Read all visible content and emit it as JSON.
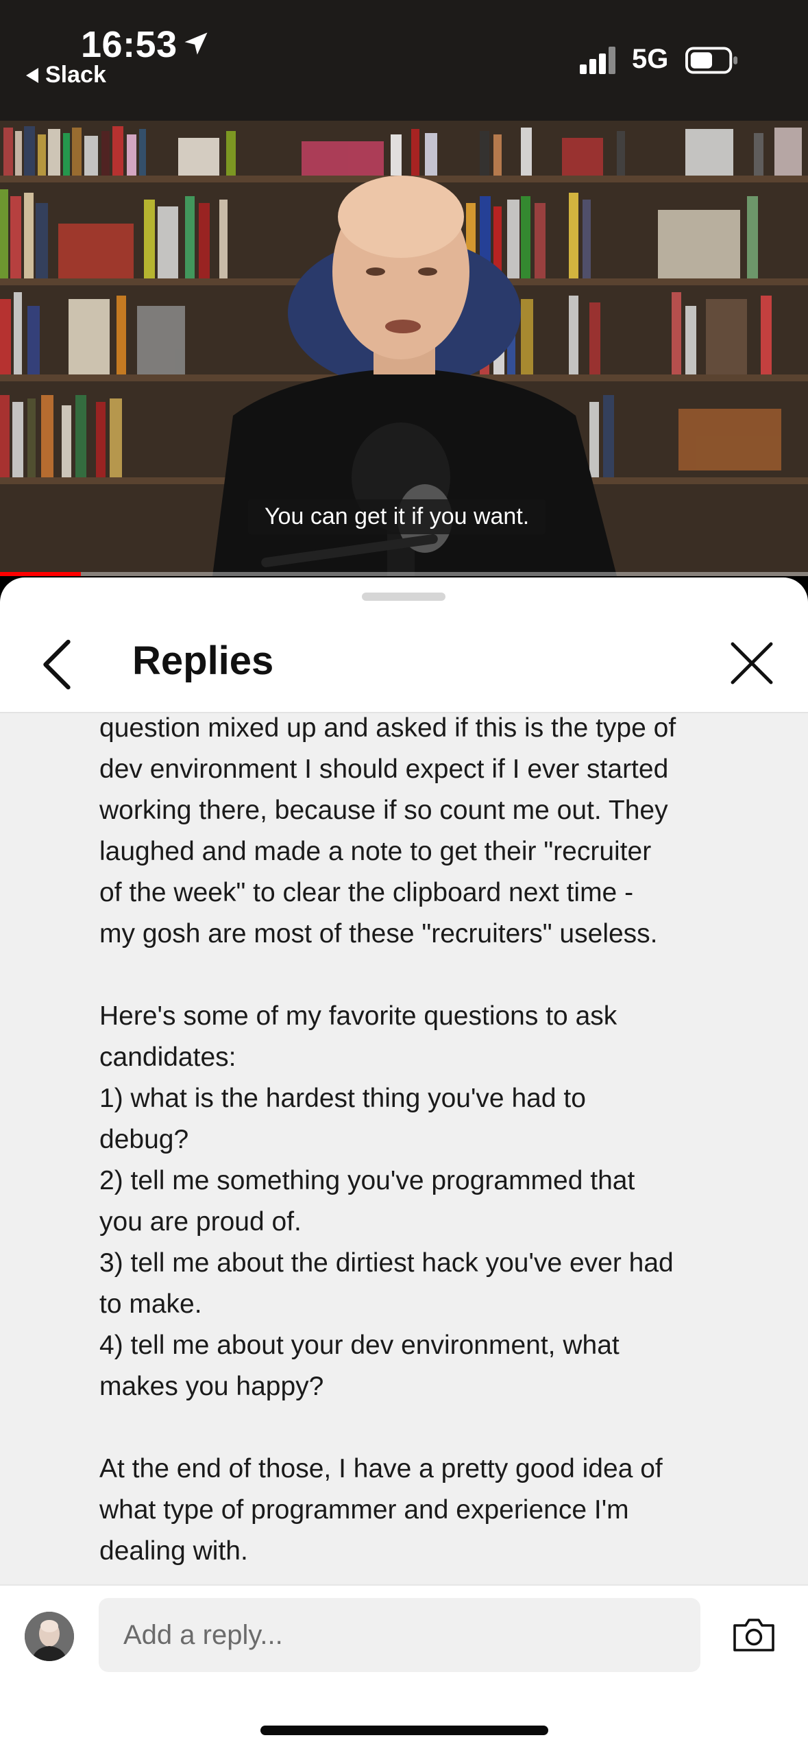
{
  "status_bar": {
    "time": "16:53",
    "back_app": "Slack",
    "network": "5G"
  },
  "video": {
    "caption": "You can get it if you want.",
    "progress": 0.1
  },
  "replies": {
    "title": "Replies",
    "message": "question mixed up and asked if this is the type of\ndev environment I should expect if I ever started\nworking there, because if so count me out. They\nlaughed and made a note to get their \"recruiter\nof the week\" to clear the clipboard next time -\nmy gosh are most of these \"recruiters\" useless.\n\nHere's some of my favorite questions to ask\ncandidates:\n1) what is the hardest thing you've had to\ndebug?\n2) tell me something you've programmed that\nyou are proud of.\n3) tell me about the dirtiest hack you've ever had\nto make.\n4) tell me about your dev environment, what\nmakes you happy?\n\nAt the end of those, I have a pretty good idea of\nwhat type of programmer and experience I'm\ndealing with."
  },
  "reply_bar": {
    "placeholder": "Add a reply..."
  },
  "icons": {
    "back": "chevron-left-icon",
    "close": "close-icon",
    "camera": "camera-icon"
  }
}
